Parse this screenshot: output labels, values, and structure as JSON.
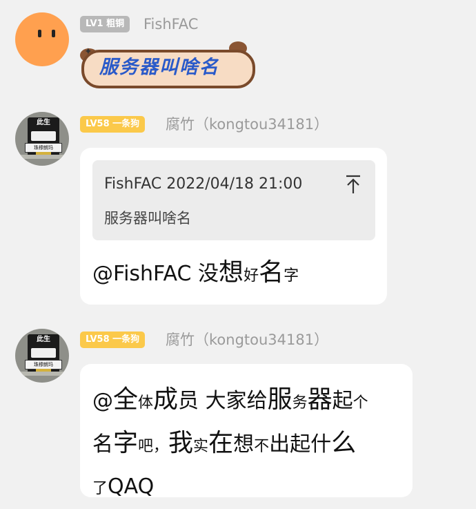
{
  "messages": [
    {
      "level": "LV1 粗铜",
      "sender": "FishFAC",
      "sticker_text": "服务器叫啥名"
    },
    {
      "level": "LV58 一条狗",
      "sender": "腐竹（kongtou34181）",
      "avatar_sign": "此生",
      "avatar_bar": "珠穆朗玛",
      "quote": {
        "author_time": "FishFAC 2022/04/18 21:00",
        "text": "服务器叫啥名"
      },
      "text_segments": [
        "@FishFAC 没",
        "想",
        "好",
        "名",
        "字"
      ]
    },
    {
      "level": "LV58 一条狗",
      "sender": "腐竹（kongtou34181）",
      "avatar_sign": "此生",
      "avatar_bar": "珠穆朗玛",
      "line1": [
        "@",
        "全",
        "体",
        "成",
        "员 大家给",
        "服",
        "务",
        "器",
        "起",
        "个"
      ],
      "line2": [
        "名",
        "字",
        "吧，",
        "我",
        "实",
        "在",
        "想",
        "不",
        "出起什",
        "么"
      ],
      "line3": [
        "了",
        "QAQ"
      ]
    }
  ]
}
